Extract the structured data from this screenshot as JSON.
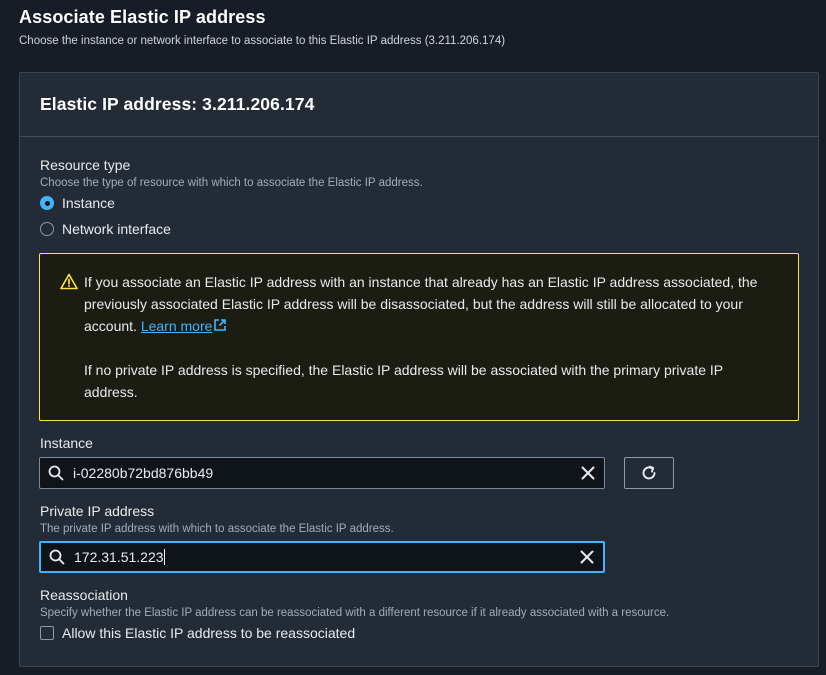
{
  "header": {
    "title": "Associate Elastic IP address",
    "description": "Choose the instance or network interface to associate to this Elastic IP address (3.211.206.174)"
  },
  "panel": {
    "title": "Elastic IP address: 3.211.206.174"
  },
  "resource_type": {
    "label": "Resource type",
    "hint": "Choose the type of resource with which to associate the Elastic IP address.",
    "options": [
      {
        "label": "Instance",
        "selected": true
      },
      {
        "label": "Network interface",
        "selected": false
      }
    ]
  },
  "alert": {
    "icon": "warning-icon",
    "paragraph1": "If you associate an Elastic IP address with an instance that already has an Elastic IP address associated, the previously associated Elastic IP address will be disassociated, but the address will still be allocated to your account.",
    "link_label": "Learn more",
    "paragraph2": "If no private IP address is specified, the Elastic IP address will be associated with the primary private IP address.",
    "border_color": "#ffe347",
    "link_color": "#42b4ff"
  },
  "instance": {
    "label": "Instance",
    "value": "i-02280b72bd876bb49"
  },
  "private_ip": {
    "label": "Private IP address",
    "hint": "The private IP address with which to associate the Elastic IP address.",
    "value": "172.31.51.223"
  },
  "reassociation": {
    "label": "Reassociation",
    "hint": "Specify whether the Elastic IP address can be reassociated with a different resource if it already associated with a resource.",
    "checkbox_label": "Allow this Elastic IP address to be reassociated",
    "checked": false
  }
}
